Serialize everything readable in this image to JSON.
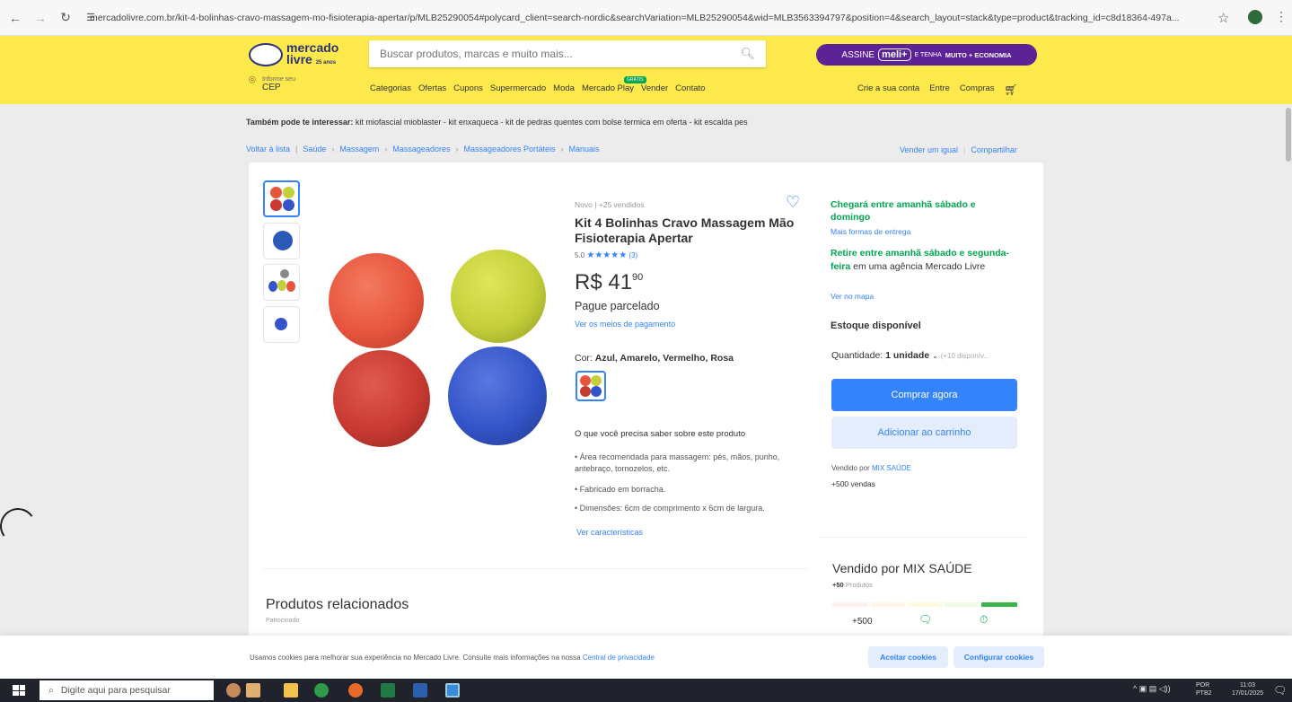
{
  "browser": {
    "url": "mercadolivre.com.br/kit-4-bolinhas-cravo-massagem-mo-fisioterapia-apertar/p/MLB25290054#polycard_client=search-nordic&searchVariation=MLB25290054&wid=MLB3563394797&position=4&search_layout=stack&type=product&tracking_id=c8d18364-497a...",
    "back_icon": "arrow-left-icon",
    "forward_icon": "arrow-right-icon",
    "reload_icon": "reload-icon",
    "bookmark_icon": "star-icon"
  },
  "header": {
    "logo_line1": "mercado",
    "logo_line2": "livre",
    "logo_badge": "25 anos",
    "search_placeholder": "Buscar produtos, marcas e muito mais...",
    "promo_text1": "ASSINE",
    "promo_badge": "meli+",
    "promo_text2": "E TENHA",
    "promo_text3": "MUITO + ECONOMIA",
    "cep_line1": "Informe seu",
    "cep_line2": "CEP",
    "nav": [
      "Categorias",
      "Ofertas",
      "Cupons",
      "Supermercado",
      "Moda",
      "Mercado Play",
      "Vender",
      "Contato"
    ],
    "new_badge": "GRÁTIS",
    "account": [
      "Crie a sua conta",
      "Entre",
      "Compras"
    ]
  },
  "interest": {
    "label": "Também pode te interessar:",
    "items": "kit miofascial mioblaster - kit enxaqueca - kit de pedras quentes com bolse termica em oferta - kit escalda pes"
  },
  "breadcrumb": {
    "back": "Voltar à lista",
    "items": [
      "Saúde",
      "Massagem",
      "Massageadores",
      "Massageadores Portáteis",
      "Manuais"
    ],
    "right": [
      "Vender um igual",
      "Compartilhar"
    ]
  },
  "product": {
    "condition": "Novo  |  +25 vendidos",
    "title": "Kit 4 Bolinhas Cravo Massagem Mão Fisioterapia Apertar",
    "rating_value": "5.0",
    "rating_stars": 5,
    "rating_count": "(3)",
    "price_main": "R$ 41",
    "price_cents": "90",
    "installment": "Pague parcelado",
    "payment_link": "Ver os meios de pagamento",
    "color_label": "Cor:",
    "color_value": "Azul, Amarelo, Vermelho, Rosa",
    "need_to_know": "O que você precisa saber sobre este produto",
    "features": [
      "Área recomendada para massagem: pés, mãos, punho, antebraço, tornozelos, etc.",
      "Fabricado em borracha.",
      "Dimensões: 6cm de comprimento x 6cm de largura."
    ],
    "features_link": "Ver características",
    "ball_colors": [
      "#e8553e",
      "#c5cf3a",
      "#c93a33",
      "#3455c9"
    ]
  },
  "shipping": {
    "arrives": "Chegará entre amanhã sábado e domingo",
    "arrives_link": "Mais formas de entrega",
    "pickup_green": "Retire entre amanhã sábado e segunda-feira",
    "pickup_rest": "em uma agência Mercado Livre",
    "map_link": "Ver no mapa",
    "stock": "Estoque disponível",
    "qty_label": "Quantidade:",
    "qty_value": "1 unidade",
    "qty_avail": "(+10 disponív...",
    "buy_label": "Comprar agora",
    "cart_label": "Adicionar ao carrinho",
    "sold_by_prefix": "Vendido por",
    "sold_by_name": "MIX SAÚDE",
    "sales": "+500 vendas"
  },
  "seller": {
    "title": "Vendido por MIX SAÚDE",
    "products_count": "+50",
    "products_label": "Produtos",
    "metric_sales": "+500"
  },
  "related": {
    "title": "Produtos relacionados",
    "sponsored": "Patrocinado"
  },
  "cookie": {
    "text": "Usamos cookies para melhorar sua experiência no Mercado Livre. Consulte mais informações na nossa",
    "link": "Central de privacidade",
    "accept": "Aceitar cookies",
    "configure": "Configurar cookies"
  },
  "taskbar": {
    "search_placeholder": "Digite aqui para pesquisar",
    "lang1": "POR",
    "lang2": "PTB2",
    "time": "11:03",
    "date": "17/01/2025"
  },
  "colors": {
    "brand_yellow": "#fde94c",
    "accent_blue": "#3483fa",
    "green": "#00a650",
    "meli_purple": "#5b2396"
  }
}
